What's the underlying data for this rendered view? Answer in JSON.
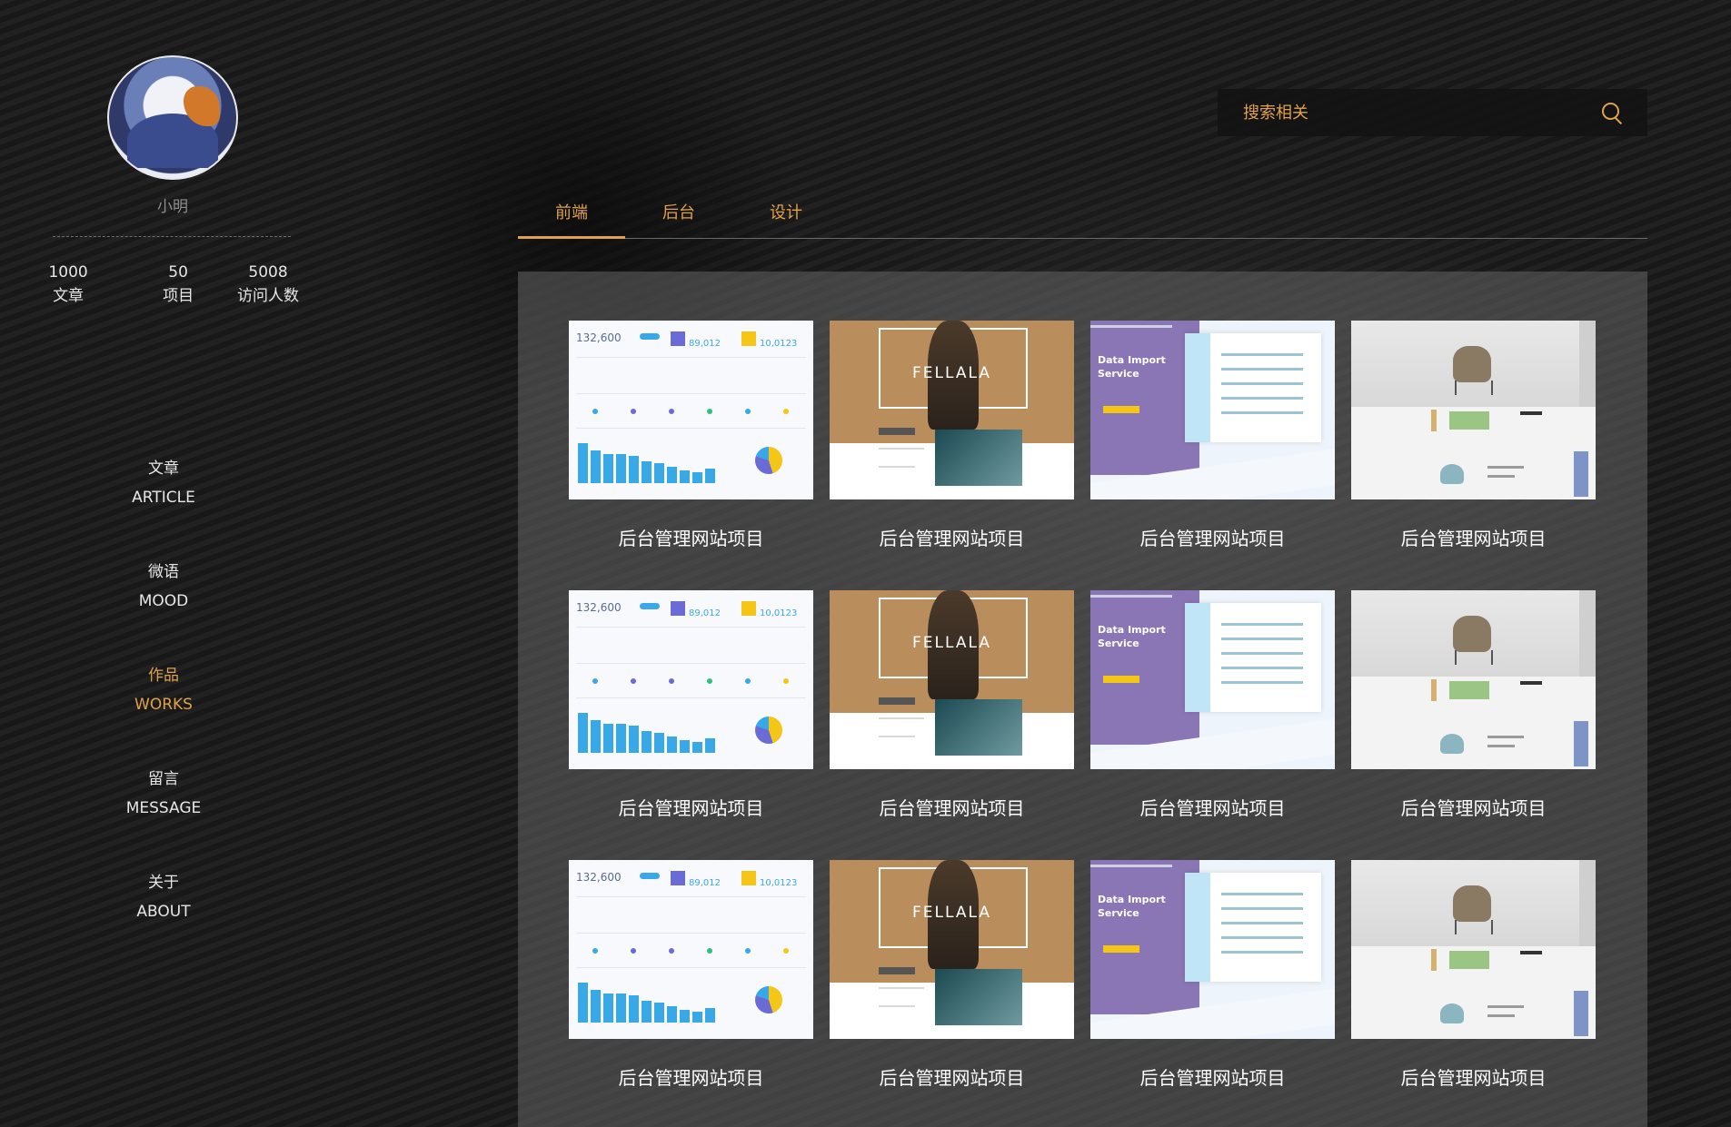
{
  "profile": {
    "name": "小明",
    "stats": [
      {
        "value": "1000",
        "label": "文章"
      },
      {
        "value": "50",
        "label": "项目"
      },
      {
        "value": "5008",
        "label": "访问人数"
      }
    ]
  },
  "nav": [
    {
      "zh": "文章",
      "en": "ARTICLE",
      "active": false
    },
    {
      "zh": "微语",
      "en": "MOOD",
      "active": false
    },
    {
      "zh": "作品",
      "en": "WORKS",
      "active": true
    },
    {
      "zh": "留言",
      "en": "MESSAGE",
      "active": false
    },
    {
      "zh": "关于",
      "en": "ABOUT",
      "active": false
    }
  ],
  "search": {
    "placeholder": "搜索相关"
  },
  "tabs": [
    {
      "label": "前端",
      "active": true
    },
    {
      "label": "后台",
      "active": false
    },
    {
      "label": "设计",
      "active": false
    }
  ],
  "works": {
    "rows": [
      [
        "后台管理网站项目",
        "后台管理网站项目",
        "后台管理网站项目",
        "后台管理网站项目"
      ],
      [
        "后台管理网站项目",
        "后台管理网站项目",
        "后台管理网站项目",
        "后台管理网站项目"
      ],
      [
        "后台管理网站项目",
        "后台管理网站项目",
        "后台管理网站项目",
        "后台管理网站项目"
      ]
    ],
    "thumb_texts": {
      "dash_main": "132,600",
      "dash_v1": "89,012",
      "dash_v2": "10,0123",
      "fashion_brand": "FELLALA",
      "data_title_1": "Data Import",
      "data_title_2": "Service"
    }
  },
  "colors": {
    "accent": "#e0a14a",
    "panel": "#646464"
  }
}
